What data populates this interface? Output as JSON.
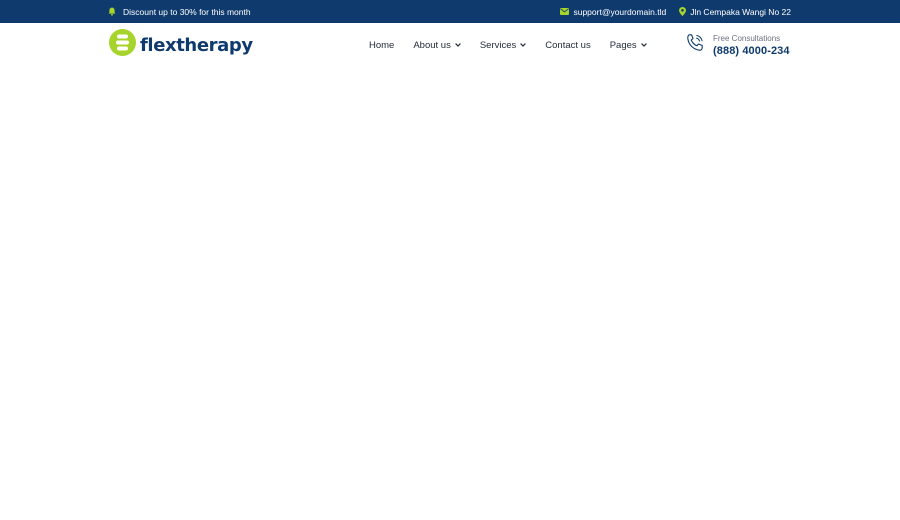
{
  "colors": {
    "topbar_bg": "#0f3a6e",
    "accent_green": "#a6d42b",
    "brand_navy": "#0f3a6e"
  },
  "topbar": {
    "promo_icon": "bell-icon",
    "promo_text": "Discount up to 30% for this month",
    "email_icon": "envelope-icon",
    "email": "support@yourdomain.tld",
    "address_icon": "map-pin-icon",
    "address": "Jln Cempaka Wangi No 22"
  },
  "header": {
    "logo_icon": "spine-logo-icon",
    "logo_text": "flextherapy",
    "nav": {
      "home": "Home",
      "about": "About us",
      "services": "Services",
      "contact": "Contact us",
      "pages": "Pages"
    },
    "contact_icon": "phone-icon",
    "consult_label": "Free Consultations",
    "phone": "(888) 4000-234"
  }
}
